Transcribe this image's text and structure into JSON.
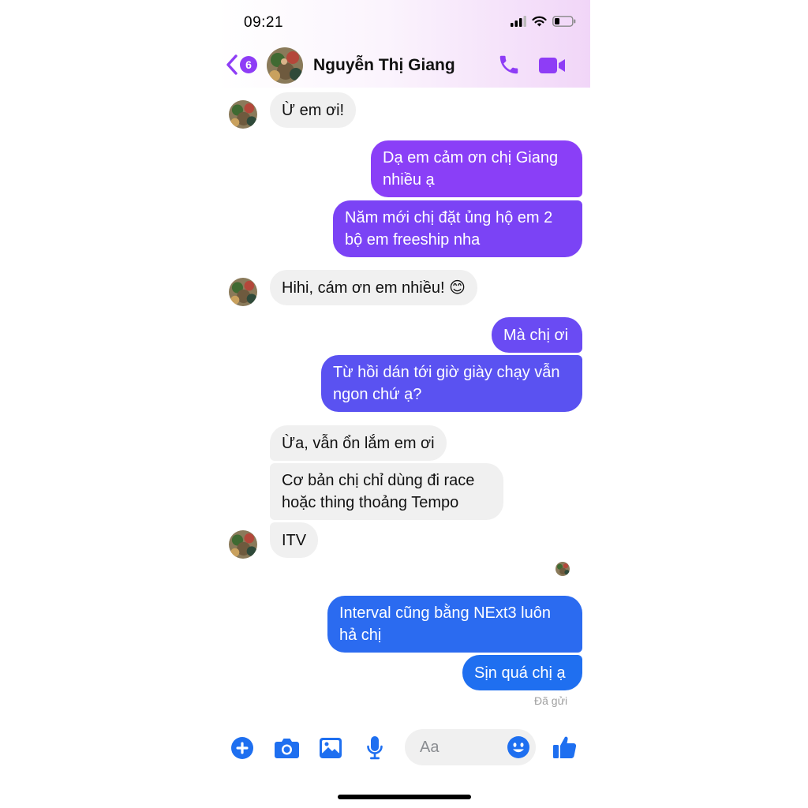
{
  "status": {
    "time": "09:21"
  },
  "header": {
    "back_count": "6",
    "contact_name": "Nguyễn Thị Giang"
  },
  "messages": [
    {
      "from": "contact",
      "text": "Ừ em ơi!"
    },
    {
      "from": "me",
      "text": "Dạ em cảm ơn chị Giang\nnhiều ạ"
    },
    {
      "from": "me",
      "text": "Năm mới chị đặt ủng hộ em 2\nbộ em freeship nha"
    },
    {
      "from": "contact",
      "text": "Hihi, cám ơn em nhiều! 😊"
    },
    {
      "from": "me",
      "text": "Mà chị ơi"
    },
    {
      "from": "me",
      "text": "Từ hồi dán tới giờ giày chạy vẫn\nngon chứ ạ?"
    },
    {
      "from": "contact",
      "text": "Ừa, vẫn ổn lắm em ơi"
    },
    {
      "from": "contact",
      "text": "Cơ bản chị chỉ dùng đi race\nhoặc thing thoảng Tempo"
    },
    {
      "from": "contact",
      "text": "ITV"
    },
    {
      "from": "me",
      "text": "Interval cũng bằng NExt3 luôn\nhả chị"
    },
    {
      "from": "me",
      "text": "Sịn quá chị ạ"
    }
  ],
  "delivery_status": "Đã gửi",
  "composer": {
    "placeholder": "Aa"
  },
  "icons": [
    "signal-icon",
    "wifi-icon",
    "battery-icon",
    "back-chevron-icon",
    "phone-icon",
    "video-camera-icon",
    "plus-icon",
    "camera-icon",
    "image-icon",
    "microphone-icon",
    "emoji-icon",
    "thumbs-up-icon"
  ],
  "colors": {
    "accent": "#8e3df6",
    "outgoing_top": "#8a3ff7",
    "outgoing_bottom": "#1f6ff0",
    "incoming": "#f0f0f0",
    "composer_icons": "#1e6ff0"
  }
}
